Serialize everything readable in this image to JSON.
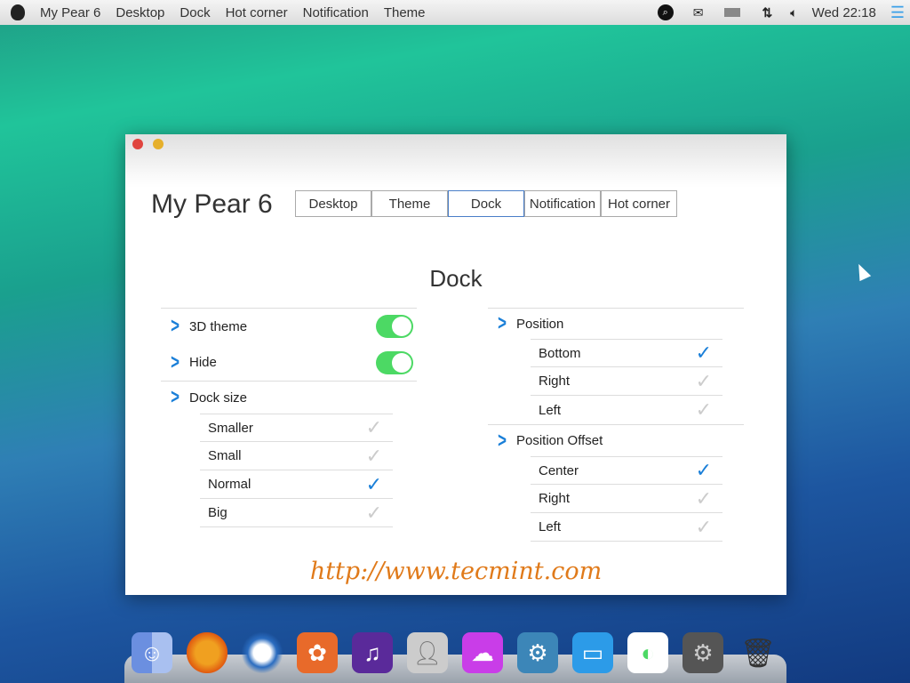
{
  "menubar": {
    "items": [
      "My Pear 6",
      "Desktop",
      "Dock",
      "Hot corner",
      "Notification",
      "Theme"
    ],
    "clock": "Wed 22:18",
    "icons": [
      "search-icon",
      "mail-icon",
      "battery-icon",
      "network-icon",
      "volume-icon",
      "list-icon"
    ]
  },
  "window": {
    "title": "My Pear 6",
    "tabs": [
      "Desktop",
      "Theme",
      "Dock",
      "Notification",
      "Hot corner"
    ],
    "selected_tab": "Dock",
    "heading": "Dock",
    "left": {
      "toggles": [
        {
          "label": "3D theme",
          "on": true
        },
        {
          "label": "Hide",
          "on": true
        }
      ],
      "dock_size": {
        "label": "Dock size",
        "options": [
          {
            "label": "Smaller",
            "checked": false
          },
          {
            "label": "Small",
            "checked": false
          },
          {
            "label": "Normal",
            "checked": true
          },
          {
            "label": "Big",
            "checked": false
          }
        ]
      }
    },
    "right": {
      "position": {
        "label": "Position",
        "options": [
          {
            "label": "Bottom",
            "checked": true
          },
          {
            "label": "Right",
            "checked": false
          },
          {
            "label": "Left",
            "checked": false
          }
        ]
      },
      "offset": {
        "label": "Position Offset",
        "options": [
          {
            "label": "Center",
            "checked": true
          },
          {
            "label": "Right",
            "checked": false
          },
          {
            "label": "Left",
            "checked": false
          }
        ]
      }
    },
    "watermark": "http://www.tecmint.com"
  },
  "dock": {
    "apps": [
      "Finder",
      "Firefox",
      "Thunderbird",
      "Photos",
      "iTunes",
      "Contacts",
      "iCloud",
      "Cydia",
      "Desktop",
      "My Pear settings",
      "System Preferences",
      "Trash"
    ]
  }
}
